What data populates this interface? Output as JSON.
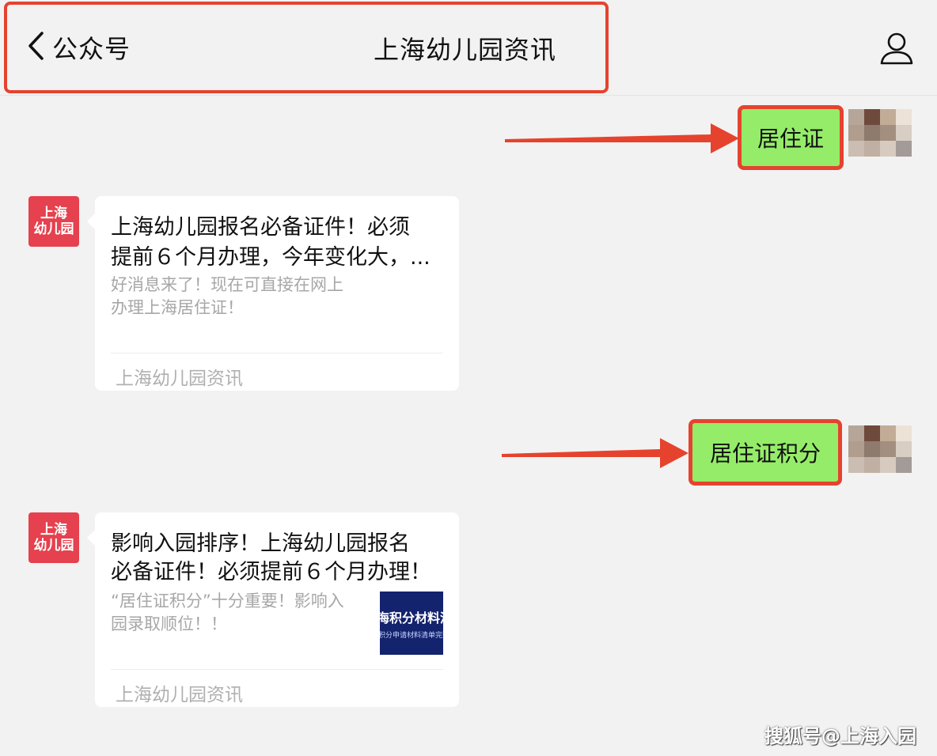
{
  "header": {
    "back_label": "公众号",
    "title": "上海幼儿园资讯"
  },
  "messages": [
    {
      "type": "user",
      "text": "居住证"
    },
    {
      "type": "article",
      "avatar_text_line1": "上海",
      "avatar_text_line2": "幼儿园",
      "title": "上海幼儿园报名必备证件！必须提前６个月办理，今年变化大，...",
      "title_line1": "上海幼儿园报名必备证件！必须",
      "title_line2": "提前６个月办理，今年变化大，...",
      "desc_line1": "好消息来了！现在可直接在网上",
      "desc_line2": "办理上海居住证！",
      "source": "上海幼儿园资讯"
    },
    {
      "type": "user",
      "text": "居住证积分"
    },
    {
      "type": "article",
      "avatar_text_line1": "上海",
      "avatar_text_line2": "幼儿园",
      "title_line1": "影响入园排序！上海幼儿园报名",
      "title_line2": "必备证件！必须提前６个月办理！",
      "desc_line1": "“居住证积分”十分重要！影响入",
      "desc_line2": "园录取顺位！！",
      "thumb_line1": "海积分材料清",
      "thumb_line2": "积分申请材料清单完整版",
      "source": "上海幼儿园资讯"
    }
  ],
  "watermark": "搜狐号@上海入园",
  "colors": {
    "highlight": "#e5432e",
    "user_bubble": "#95ec69",
    "account_avatar": "#e5414e",
    "background": "#f2f2f2"
  }
}
